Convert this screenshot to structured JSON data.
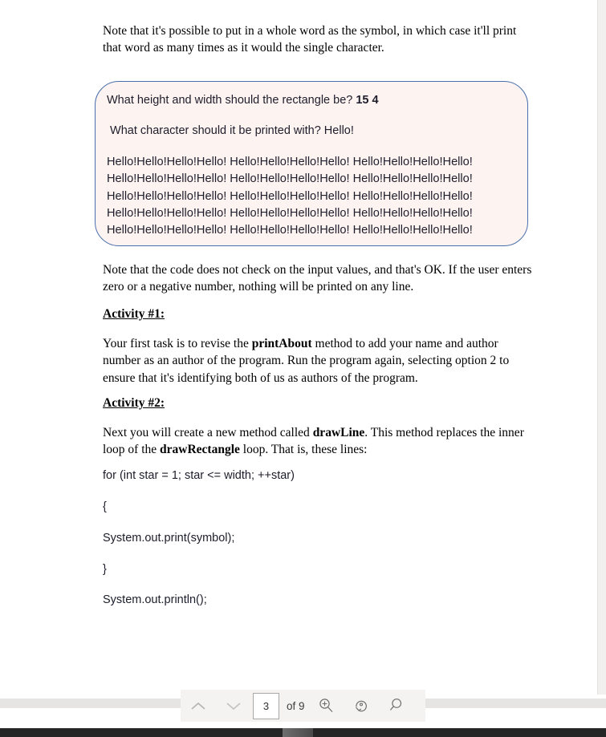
{
  "document": {
    "paragraph_1": "Note that it's possible to put in a whole word as the symbol, in which case it'll print that word as many times as it would the single character.",
    "console": {
      "prompt_1_text": "What height and width should the rectangle be? ",
      "prompt_1_answer": "15 4",
      "prompt_2": " What character should it be printed with? Hello!",
      "output_lines": [
        "Hello!Hello!Hello!Hello! Hello!Hello!Hello!Hello! Hello!Hello!Hello!Hello!",
        "Hello!Hello!Hello!Hello! Hello!Hello!Hello!Hello! Hello!Hello!Hello!Hello!",
        "Hello!Hello!Hello!Hello! Hello!Hello!Hello!Hello! Hello!Hello!Hello!Hello!",
        "Hello!Hello!Hello!Hello! Hello!Hello!Hello!Hello! Hello!Hello!Hello!Hello!",
        "Hello!Hello!Hello!Hello! Hello!Hello!Hello!Hello! Hello!Hello!Hello!Hello!"
      ],
      "border_color": "#4b6fae",
      "background_color": "#fdf3f1"
    },
    "paragraph_2": "Note that the code does not check on the input values, and that's OK. If the user enters zero or a negative number, nothing will be printed on any line.",
    "activity_1_heading": "Activity #1:",
    "activity_1_part_a": "Your first task is to revise the ",
    "activity_1_bold": "printAbout",
    "activity_1_part_b": " method to add your name and author number as an author of the program. Run the program again, selecting option 2 to ensure that it's identifying both of us as authors of the program.",
    "activity_2_heading": "Activity #2:",
    "activity_2_part_a": "Next you will create a new method called ",
    "activity_2_bold_1": "drawLine",
    "activity_2_part_b": ". This method replaces the inner loop of the ",
    "activity_2_bold_2": "drawRectangle",
    "activity_2_part_c": " loop. That is, these lines:",
    "code_lines": [
      "for (int star = 1; star <= width; ++star)",
      "{",
      "System.out.print(symbol);",
      "}",
      "System.out.println();"
    ]
  },
  "toolbar": {
    "previous_page_icon": "chevron-up-icon",
    "next_page_icon": "chevron-down-icon",
    "page_number": "3",
    "page_count": "of 9",
    "zoom_in_icon": "zoom-in-icon",
    "rotate_icon": "rotate-clockwise-icon",
    "search_icon": "search-icon"
  }
}
